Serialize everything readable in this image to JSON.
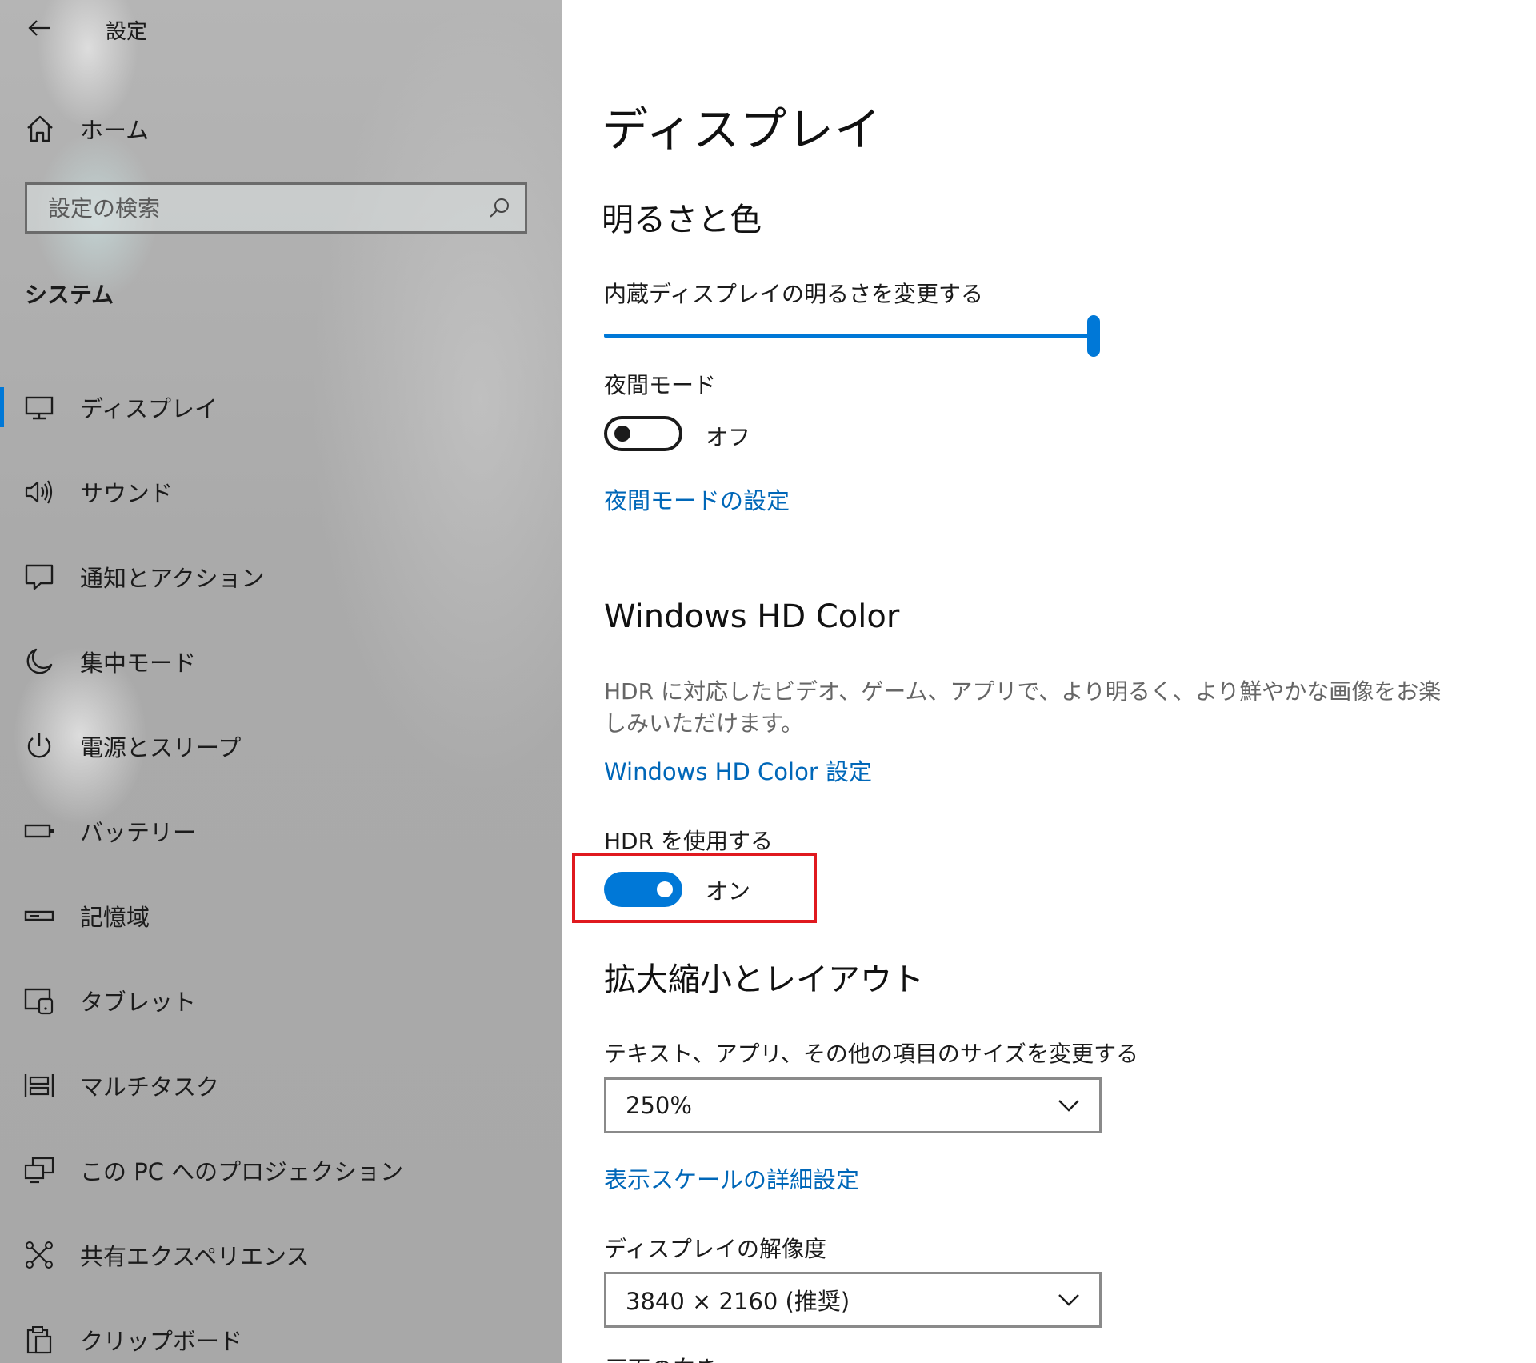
{
  "window": {
    "title": "設定"
  },
  "sidebar": {
    "home_label": "ホーム",
    "search_placeholder": "設定の検索",
    "section_title": "システム",
    "items": [
      {
        "label": "ディスプレイ",
        "icon": "monitor-icon",
        "active": true
      },
      {
        "label": "サウンド",
        "icon": "speaker-icon"
      },
      {
        "label": "通知とアクション",
        "icon": "message-icon"
      },
      {
        "label": "集中モード",
        "icon": "moon-icon"
      },
      {
        "label": "電源とスリープ",
        "icon": "power-icon"
      },
      {
        "label": "バッテリー",
        "icon": "battery-icon"
      },
      {
        "label": "記憶域",
        "icon": "storage-icon"
      },
      {
        "label": "タブレット",
        "icon": "tablet-icon"
      },
      {
        "label": "マルチタスク",
        "icon": "multitask-icon"
      },
      {
        "label": "この PC へのプロジェクション",
        "icon": "projection-icon"
      },
      {
        "label": "共有エクスペリエンス",
        "icon": "share-icon"
      },
      {
        "label": "クリップボード",
        "icon": "clipboard-icon"
      }
    ]
  },
  "main": {
    "title": "ディスプレイ",
    "brightness": {
      "heading": "明るさと色",
      "slider_label": "内蔵ディスプレイの明るさを変更する",
      "value_percent": 100
    },
    "night_mode": {
      "label": "夜間モード",
      "state": "オフ",
      "settings_link": "夜間モードの設定"
    },
    "hd_color": {
      "heading": "Windows HD Color",
      "description": "HDR に対応したビデオ、ゲーム、アプリで、より明るく、より鮮やかな画像をお楽しみいただけます。",
      "settings_link": "Windows HD Color 設定",
      "hdr_label": "HDR を使用する",
      "hdr_state": "オン"
    },
    "scale_layout": {
      "heading": "拡大縮小とレイアウト",
      "size_label": "テキスト、アプリ、その他の項目のサイズを変更する",
      "size_value": "250%",
      "advanced_link": "表示スケールの詳細設定",
      "resolution_label": "ディスプレイの解像度",
      "resolution_value": "3840 × 2160 (推奨)",
      "orientation_label": "画面の向き"
    }
  },
  "colors": {
    "accent": "#0078d7",
    "link": "#0067b8",
    "highlight": "#e0191f"
  }
}
